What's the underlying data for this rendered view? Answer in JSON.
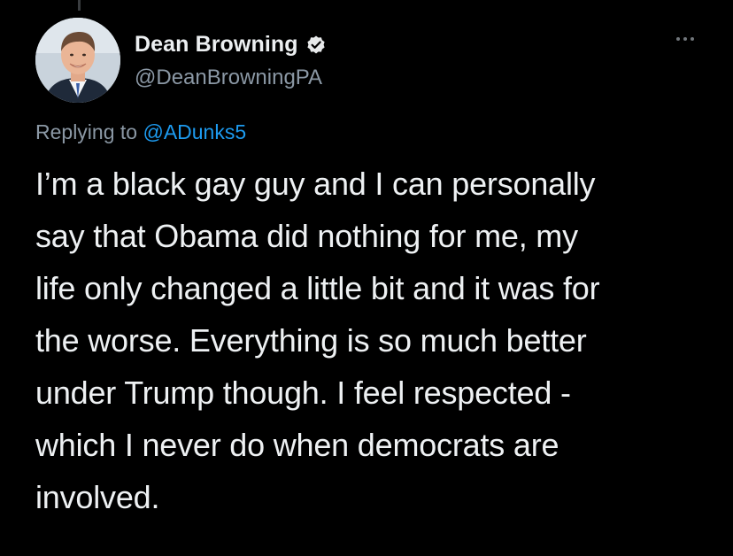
{
  "author": {
    "display_name": "Dean Browning",
    "handle": "@DeanBrowningPA",
    "verified": true,
    "avatar_icon": "profile-photo"
  },
  "reply": {
    "prefix": "Replying to",
    "mention": "@ADunks5"
  },
  "tweet": {
    "text": "I’m a black gay guy and I can personally\nsay that Obama did nothing for me, my\nlife only changed a little bit and it was for\nthe worse. Everything is so much better\nunder Trump though. I feel respected -\nwhich I never do when democrats are\ninvolved."
  },
  "menu": {
    "icon": "more-options-icon"
  },
  "colors": {
    "background": "#000000",
    "text": "#e7e9ea",
    "secondary": "#8b98a5",
    "link": "#1d9bf0"
  }
}
